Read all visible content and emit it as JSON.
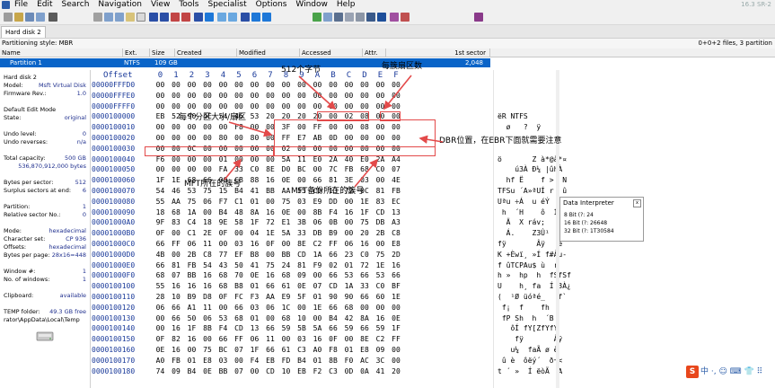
{
  "menubar": {
    "items": [
      "File",
      "Edit",
      "Search",
      "Navigation",
      "View",
      "Tools",
      "Specialist",
      "Options",
      "Window",
      "Help"
    ],
    "version": "16.3 SR-2"
  },
  "tab": {
    "label": "Hard disk 2"
  },
  "infobar": {
    "left": "Partitioning style: MBR",
    "right": "0+0+2 files, 3 partition"
  },
  "partition_table": {
    "headers": [
      "Name",
      "Ext.",
      "Size",
      "Created",
      "Modified",
      "Accessed",
      "Attr.",
      "1st sector"
    ],
    "row": {
      "name": "Partition 1",
      "ext": "NTFS",
      "size": "109 GB",
      "first_sector": "2,048"
    }
  },
  "info_panel": [
    {
      "k": "Hard disk 2",
      "v": ""
    },
    {
      "k": "Model:",
      "v": "Msft   Virtual Disk"
    },
    {
      "k": "Firmware Rev.:",
      "v": "1.0"
    },
    {
      "k": "",
      "v": ""
    },
    {
      "k": "Default Edit Mode",
      "v": ""
    },
    {
      "k": "State:",
      "v": "original"
    },
    {
      "k": "",
      "v": ""
    },
    {
      "k": "Undo level:",
      "v": "0"
    },
    {
      "k": "Undo reverses:",
      "v": "n/a"
    },
    {
      "k": "",
      "v": ""
    },
    {
      "k": "Total capacity:",
      "v": "500 GB"
    },
    {
      "k": "",
      "v": "536,870,912,000 bytes"
    },
    {
      "k": "",
      "v": ""
    },
    {
      "k": "Bytes per sector:",
      "v": "512"
    },
    {
      "k": "Surplus sectors at end:",
      "v": "6"
    },
    {
      "k": "",
      "v": ""
    },
    {
      "k": "Partition:",
      "v": "1"
    },
    {
      "k": "Relative sector No.:",
      "v": "0"
    },
    {
      "k": "",
      "v": ""
    },
    {
      "k": "Mode:",
      "v": "hexadecimal"
    },
    {
      "k": "Character set:",
      "v": "CP 936"
    },
    {
      "k": "Offsets:",
      "v": "hexadecimal"
    },
    {
      "k": "Bytes per page:",
      "v": "28x16=448"
    },
    {
      "k": "",
      "v": ""
    },
    {
      "k": "Window #:",
      "v": "1"
    },
    {
      "k": "No. of windows:",
      "v": "1"
    },
    {
      "k": "",
      "v": ""
    },
    {
      "k": "Clipboard:",
      "v": "available"
    },
    {
      "k": "",
      "v": ""
    },
    {
      "k": "TEMP folder:",
      "v": "49.3 GB free"
    },
    {
      "k": "rator\\AppData\\Local\\Temp",
      "v": ""
    }
  ],
  "hex": {
    "offset_label": "Offset",
    "columns": [
      "0",
      "1",
      "2",
      "3",
      "4",
      "5",
      "6",
      "7",
      "8",
      "9",
      "A",
      "B",
      "C",
      "D",
      "E",
      "F"
    ],
    "rows": [
      {
        "off": "00000FFFD0",
        "b": [
          "00",
          "00",
          "00",
          "00",
          "00",
          "00",
          "00",
          "00",
          "00",
          "00",
          "00",
          "00",
          "00",
          "00",
          "00",
          "00"
        ],
        "a": ""
      },
      {
        "off": "00000FFFE0",
        "b": [
          "00",
          "00",
          "00",
          "00",
          "00",
          "00",
          "00",
          "00",
          "00",
          "00",
          "00",
          "00",
          "00",
          "00",
          "00",
          "00"
        ],
        "a": ""
      },
      {
        "off": "00000FFFF0",
        "b": [
          "00",
          "00",
          "00",
          "00",
          "00",
          "00",
          "00",
          "00",
          "00",
          "00",
          "00",
          "00",
          "00",
          "00",
          "00",
          "00"
        ],
        "a": ""
      },
      {
        "off": "0000100000",
        "b": [
          "EB",
          "52",
          "90",
          "4E",
          "54",
          "46",
          "53",
          "20",
          "20",
          "20",
          "20",
          "00",
          "02",
          "08",
          "00",
          "00"
        ],
        "a": "ëR NTFS"
      },
      {
        "off": "0000100010",
        "b": [
          "00",
          "00",
          "00",
          "00",
          "00",
          "F8",
          "00",
          "00",
          "3F",
          "00",
          "FF",
          "00",
          "00",
          "08",
          "00",
          "00"
        ],
        "a": "  ø   ?  ÿ"
      },
      {
        "off": "0000100020",
        "b": [
          "00",
          "00",
          "00",
          "00",
          "80",
          "00",
          "80",
          "00",
          "FF",
          "E7",
          "AB",
          "0D",
          "00",
          "00",
          "00",
          "00"
        ],
        "a": ""
      },
      {
        "off": "0000100030",
        "b": [
          "00",
          "00",
          "0C",
          "00",
          "00",
          "00",
          "00",
          "00",
          "02",
          "00",
          "00",
          "00",
          "00",
          "00",
          "00",
          "00"
        ],
        "a": ""
      },
      {
        "off": "0000100040",
        "b": [
          "F6",
          "00",
          "00",
          "00",
          "01",
          "00",
          "00",
          "00",
          "5A",
          "11",
          "E0",
          "2A",
          "40",
          "E0",
          "2A",
          "A4"
        ],
        "a": "ö       Z à*@à*¤"
      },
      {
        "off": "0000100050",
        "b": [
          "00",
          "00",
          "00",
          "00",
          "FA",
          "33",
          "C0",
          "8E",
          "D0",
          "BC",
          "00",
          "7C",
          "FB",
          "68",
          "C0",
          "07"
        ],
        "a": "    ú3À Ð¼ |ûhÀ"
      },
      {
        "off": "0000100060",
        "b": [
          "1F",
          "1E",
          "68",
          "66",
          "00",
          "CB",
          "88",
          "16",
          "0E",
          "00",
          "66",
          "81",
          "3E",
          "03",
          "00",
          "4E"
        ],
        "a": "  hf Ë    f >  N"
      },
      {
        "off": "0000100070",
        "b": [
          "54",
          "46",
          "53",
          "75",
          "15",
          "B4",
          "41",
          "BB",
          "AA",
          "55",
          "CD",
          "13",
          "72",
          "0C",
          "81",
          "FB"
        ],
        "a": "TFSu ´A»ªUÍ r  û"
      },
      {
        "off": "0000100080",
        "b": [
          "55",
          "AA",
          "75",
          "06",
          "F7",
          "C1",
          "01",
          "00",
          "75",
          "03",
          "E9",
          "DD",
          "00",
          "1E",
          "83",
          "EC"
        ],
        "a": "Uªu ÷Á  u éÝ  ì"
      },
      {
        "off": "0000100090",
        "b": [
          "18",
          "68",
          "1A",
          "00",
          "B4",
          "48",
          "8A",
          "16",
          "0E",
          "00",
          "8B",
          "F4",
          "16",
          "1F",
          "CD",
          "13"
        ],
        "a": " h  ´H    ô  Í"
      },
      {
        "off": "00001000A0",
        "b": [
          "9F",
          "83",
          "C4",
          "18",
          "9E",
          "58",
          "1F",
          "72",
          "E1",
          "3B",
          "06",
          "0B",
          "00",
          "75",
          "DB",
          "A3"
        ],
        "a": "  Ä  X ráv;   uÛ£"
      },
      {
        "off": "00001000B0",
        "b": [
          "0F",
          "00",
          "C1",
          "2E",
          "0F",
          "00",
          "04",
          "1E",
          "5A",
          "33",
          "DB",
          "B9",
          "00",
          "20",
          "2B",
          "C8"
        ],
        "a": "  Á.    Z3Û¹  +È"
      },
      {
        "off": "00001000C0",
        "b": [
          "66",
          "FF",
          "06",
          "11",
          "00",
          "03",
          "16",
          "0F",
          "00",
          "8E",
          "C2",
          "FF",
          "06",
          "16",
          "00",
          "E8"
        ],
        "a": "fÿ       Âÿ   è"
      },
      {
        "off": "00001000D0",
        "b": [
          "4B",
          "00",
          "2B",
          "C8",
          "77",
          "EF",
          "B8",
          "00",
          "BB",
          "CD",
          "1A",
          "66",
          "23",
          "C0",
          "75",
          "2D"
        ],
        "a": "K +Èwï¸ »Í f#Àu-"
      },
      {
        "off": "00001000E0",
        "b": [
          "66",
          "81",
          "FB",
          "54",
          "43",
          "50",
          "41",
          "75",
          "24",
          "81",
          "F9",
          "02",
          "01",
          "72",
          "1E",
          "16"
        ],
        "a": "f ûTCPAu$ ù  r"
      },
      {
        "off": "00001000F0",
        "b": [
          "68",
          "07",
          "BB",
          "16",
          "68",
          "70",
          "0E",
          "16",
          "68",
          "09",
          "00",
          "66",
          "53",
          "66",
          "53",
          "66"
        ],
        "a": "h »  hp  h  fSfSf"
      },
      {
        "off": "0000100100",
        "b": [
          "55",
          "16",
          "16",
          "16",
          "68",
          "B8",
          "01",
          "66",
          "61",
          "0E",
          "07",
          "CD",
          "1A",
          "33",
          "C0",
          "BF"
        ],
        "a": "U    h¸ fa  Í 3À¿"
      },
      {
        "off": "0000100110",
        "b": [
          "28",
          "10",
          "B9",
          "D8",
          "0F",
          "FC",
          "F3",
          "AA",
          "E9",
          "5F",
          "01",
          "90",
          "90",
          "66",
          "60",
          "1E"
        ],
        "a": "(  ¹Ø üóªé_   f`"
      },
      {
        "off": "0000100120",
        "b": [
          "06",
          "66",
          "A1",
          "11",
          "00",
          "66",
          "03",
          "06",
          "1C",
          "00",
          "1E",
          "66",
          "68",
          "00",
          "00",
          "00"
        ],
        "a": " f¡  f    fh"
      },
      {
        "off": "0000100130",
        "b": [
          "00",
          "66",
          "50",
          "06",
          "53",
          "68",
          "01",
          "00",
          "68",
          "10",
          "00",
          "B4",
          "42",
          "8A",
          "16",
          "0E"
        ],
        "a": " fP Sh  h  ´B"
      },
      {
        "off": "0000100140",
        "b": [
          "00",
          "16",
          "1F",
          "8B",
          "F4",
          "CD",
          "13",
          "66",
          "59",
          "5B",
          "5A",
          "66",
          "59",
          "66",
          "59",
          "1F"
        ],
        "a": "   ôÍ fY[ZfYfY"
      },
      {
        "off": "0000100150",
        "b": [
          "0F",
          "82",
          "16",
          "00",
          "66",
          "FF",
          "06",
          "11",
          "00",
          "03",
          "16",
          "0F",
          "00",
          "8E",
          "C2",
          "FF"
        ],
        "a": "    fÿ       Âÿ"
      },
      {
        "off": "0000100160",
        "b": [
          "0E",
          "16",
          "00",
          "75",
          "BC",
          "07",
          "1F",
          "66",
          "61",
          "C3",
          "A0",
          "F8",
          "01",
          "E8",
          "09",
          "00"
        ],
        "a": "   u¼  faÃ ø è"
      },
      {
        "off": "0000100170",
        "b": [
          "A0",
          "FB",
          "01",
          "E8",
          "03",
          "00",
          "F4",
          "EB",
          "FD",
          "B4",
          "01",
          "8B",
          "F0",
          "AC",
          "3C",
          "00"
        ],
        "a": " û è  ôëý´  ð¬<"
      },
      {
        "off": "0000100180",
        "b": [
          "74",
          "09",
          "B4",
          "0E",
          "BB",
          "07",
          "00",
          "CD",
          "10",
          "EB",
          "F2",
          "C3",
          "0D",
          "0A",
          "41",
          "20"
        ],
        "a": "t ´ »  Í ëòÃ  A"
      }
    ]
  },
  "interpreter": {
    "title": "Data Interpreter",
    "rows": [
      "8 Bit (?: 24",
      "16 Bit (?: 26648",
      "32 Bit (?: 1T30584"
    ]
  },
  "annotations": [
    "512个字节",
    "每簇扇区数",
    "每个分区大小/扇区",
    "DBR位置，在EBR下面就需要注意",
    "MFT所在的簇号",
    "MFT备份所在的簇号"
  ],
  "ime": {
    "logo": "S",
    "text": "中 ·, ☺ ⌨ 👕 ⠿"
  }
}
